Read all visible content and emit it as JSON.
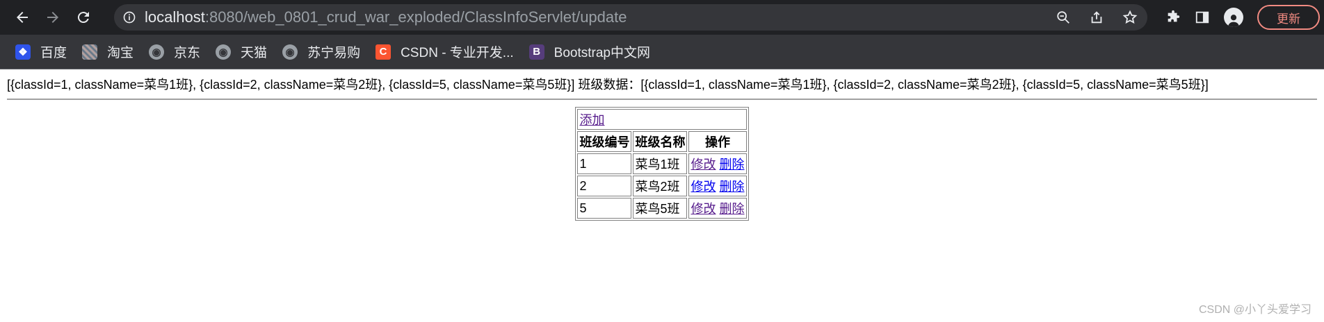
{
  "browser": {
    "url_host": "localhost",
    "url_rest": ":8080/web_0801_crud_war_exploded/ClassInfoServlet/update",
    "update_label": "更新"
  },
  "bookmarks": [
    {
      "label": "百度",
      "icon": "baidu-icon"
    },
    {
      "label": "淘宝",
      "icon": "taobao-icon"
    },
    {
      "label": "京东",
      "icon": "globe-icon"
    },
    {
      "label": "天猫",
      "icon": "globe-icon"
    },
    {
      "label": "苏宁易购",
      "icon": "globe-icon"
    },
    {
      "label": "CSDN - 专业开发...",
      "icon": "csdn-icon",
      "glyph": "C"
    },
    {
      "label": "Bootstrap中文网",
      "icon": "bootstrap-icon",
      "glyph": "B"
    }
  ],
  "page": {
    "data_line": "[{classId=1, className=菜鸟1班}, {classId=2, className=菜鸟2班}, {classId=5, className=菜鸟5班}] 班级数据：[{classId=1, className=菜鸟1班}, {classId=2, className=菜鸟2班}, {classId=5, className=菜鸟5班}]",
    "add_link": "添加",
    "headers": [
      "班级编号",
      "班级名称",
      "操作"
    ],
    "rows": [
      {
        "id": "1",
        "name": "菜鸟1班",
        "edit": "修改",
        "delete": "删除"
      },
      {
        "id": "2",
        "name": "菜鸟2班",
        "edit": "修改",
        "delete": "删除"
      },
      {
        "id": "5",
        "name": "菜鸟5班",
        "edit": "修改",
        "delete": "删除"
      }
    ],
    "watermark": "CSDN @小丫头爱学习"
  }
}
